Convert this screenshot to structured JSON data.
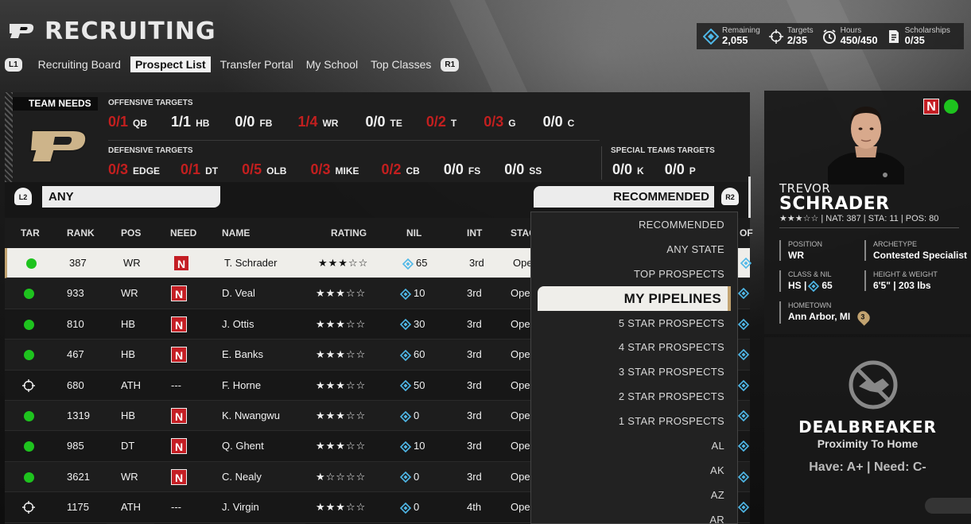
{
  "header": {
    "title": "RECRUITING",
    "nav": {
      "l1": "L1",
      "r1": "R1",
      "tabs": [
        "Recruiting Board",
        "Prospect List",
        "Transfer Portal",
        "My School",
        "Top Classes"
      ],
      "active": "Prospect List"
    }
  },
  "stats": {
    "remaining": {
      "label": "Remaining",
      "value": "2,055"
    },
    "targets": {
      "label": "Targets",
      "value": "2/35"
    },
    "hours": {
      "label": "Hours",
      "value": "450/450"
    },
    "scholarships": {
      "label": "Scholarships",
      "value": "0/35"
    }
  },
  "team_needs": {
    "label": "TEAM NEEDS",
    "offense_label": "OFFENSIVE TARGETS",
    "defense_label": "DEFENSIVE TARGETS",
    "special_label": "SPECIAL TEAMS TARGETS",
    "offense": [
      {
        "cnt": "0/1",
        "pos": "QB",
        "red": true
      },
      {
        "cnt": "1/1",
        "pos": "HB",
        "red": false
      },
      {
        "cnt": "0/0",
        "pos": "FB",
        "red": false
      },
      {
        "cnt": "1/4",
        "pos": "WR",
        "red": true
      },
      {
        "cnt": "0/0",
        "pos": "TE",
        "red": false
      },
      {
        "cnt": "0/2",
        "pos": "T",
        "red": true
      },
      {
        "cnt": "0/3",
        "pos": "G",
        "red": true
      },
      {
        "cnt": "0/0",
        "pos": "C",
        "red": false
      }
    ],
    "defense": [
      {
        "cnt": "0/3",
        "pos": "EDGE",
        "red": true
      },
      {
        "cnt": "0/1",
        "pos": "DT",
        "red": true
      },
      {
        "cnt": "0/5",
        "pos": "OLB",
        "red": true
      },
      {
        "cnt": "0/3",
        "pos": "MIKE",
        "red": true
      },
      {
        "cnt": "0/2",
        "pos": "CB",
        "red": true
      },
      {
        "cnt": "0/0",
        "pos": "FS",
        "red": false
      },
      {
        "cnt": "0/0",
        "pos": "SS",
        "red": false
      }
    ],
    "special": [
      {
        "cnt": "0/0",
        "pos": "K",
        "red": false
      },
      {
        "cnt": "0/0",
        "pos": "P",
        "red": false
      }
    ]
  },
  "filters": {
    "left": "ANY",
    "right": "RECOMMENDED",
    "l2": "L2",
    "r2": "R2"
  },
  "table": {
    "headers": [
      "TAR",
      "RANK",
      "POS",
      "NEED",
      "NAME",
      "RATING",
      "NIL",
      "INT",
      "STAG",
      "OF"
    ],
    "rows": [
      {
        "tar": "dot",
        "rank": "387",
        "pos": "WR",
        "need": "N",
        "name": "T. Schrader",
        "stars": "★★★☆☆",
        "nil": "65",
        "int": "3rd",
        "stage": "Open"
      },
      {
        "tar": "dot",
        "rank": "933",
        "pos": "WR",
        "need": "N",
        "name": "D. Veal",
        "stars": "★★★☆☆",
        "nil": "10",
        "int": "3rd",
        "stage": "Open"
      },
      {
        "tar": "dot",
        "rank": "810",
        "pos": "HB",
        "need": "N",
        "name": "J. Ottis",
        "stars": "★★★☆☆",
        "nil": "30",
        "int": "3rd",
        "stage": "Open"
      },
      {
        "tar": "dot",
        "rank": "467",
        "pos": "HB",
        "need": "N",
        "name": "E. Banks",
        "stars": "★★★☆☆",
        "nil": "60",
        "int": "3rd",
        "stage": "Open"
      },
      {
        "tar": "target",
        "rank": "680",
        "pos": "ATH",
        "need": "---",
        "name": "F. Horne",
        "stars": "★★★☆☆",
        "nil": "50",
        "int": "3rd",
        "stage": "Open"
      },
      {
        "tar": "dot",
        "rank": "1319",
        "pos": "HB",
        "need": "N",
        "name": "K. Nwangwu",
        "stars": "★★★☆☆",
        "nil": "0",
        "int": "3rd",
        "stage": "Open"
      },
      {
        "tar": "dot",
        "rank": "985",
        "pos": "DT",
        "need": "N",
        "name": "Q. Ghent",
        "stars": "★★★☆☆",
        "nil": "10",
        "int": "3rd",
        "stage": "Open"
      },
      {
        "tar": "dot",
        "rank": "3621",
        "pos": "WR",
        "need": "N",
        "name": "C. Nealy",
        "stars": "★☆☆☆☆",
        "nil": "0",
        "int": "3rd",
        "stage": "Open"
      },
      {
        "tar": "target",
        "rank": "1175",
        "pos": "ATH",
        "need": "---",
        "name": "J. Virgin",
        "stars": "★★★☆☆",
        "nil": "0",
        "int": "4th",
        "stage": "Open"
      }
    ]
  },
  "dropdown": {
    "items": [
      "RECOMMENDED",
      "ANY STATE",
      "TOP PROSPECTS",
      "MY PIPELINES",
      "5 STAR PROSPECTS",
      "4 STAR PROSPECTS",
      "3 STAR PROSPECTS",
      "2 STAR PROSPECTS",
      "1 STAR PROSPECTS",
      "AL",
      "AK",
      "AZ",
      "AR"
    ],
    "selected": "MY PIPELINES"
  },
  "player": {
    "first": "TREVOR",
    "last": "SCHRADER",
    "summary": "★★★☆☆ | NAT: 387 | STA: 11 | POS: 80",
    "position_label": "POSITION",
    "position": "WR",
    "archetype_label": "ARCHETYPE",
    "archetype": "Contested Specialist",
    "class_label": "CLASS & NIL",
    "class_prefix": "HS |",
    "nil": "65",
    "hw_label": "HEIGHT & WEIGHT",
    "hw": "6'5\" | 203 lbs",
    "hometown_label": "HOMETOWN",
    "hometown": "Ann Arbor, MI",
    "pipeline_badge": "3",
    "n_badge": "N"
  },
  "dealbreaker": {
    "title": "DEALBREAKER",
    "subtitle": "Proximity To Home",
    "have_need": "Have: A+ | Need: C-"
  },
  "colors": {
    "accent_red": "#c41e24",
    "green": "#1ec31e",
    "gold": "#c2a370",
    "nil_blue": "#4fb8e8"
  }
}
